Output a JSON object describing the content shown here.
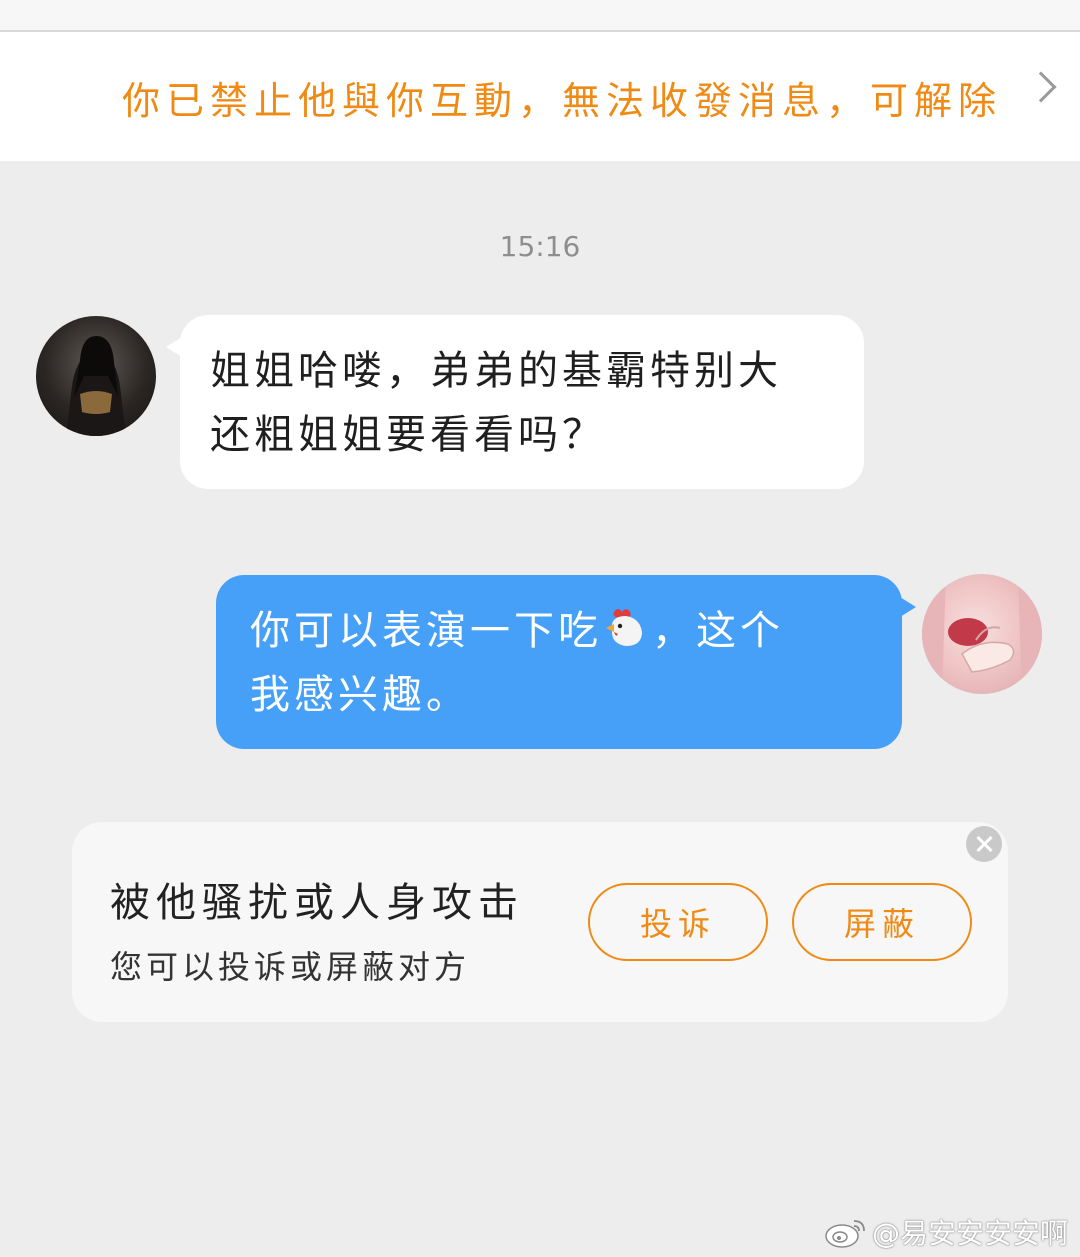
{
  "notice": {
    "text": "你已禁止他與你互動，無法收發消息，可解除"
  },
  "chat": {
    "timestamp": "15:16",
    "messages": [
      {
        "sender": "other",
        "lines": [
          "姐姐哈喽，弟弟的基霸特别大",
          "还粗姐姐要看看吗？"
        ]
      },
      {
        "sender": "self",
        "line1_before": "你可以表演一下吃",
        "emoji": "chicken-emoji",
        "line1_after": "，这个",
        "line2": "我感兴趣。"
      }
    ]
  },
  "report_card": {
    "title": "被他骚扰或人身攻击",
    "subtitle": "您可以投诉或屏蔽对方",
    "report_label": "投诉",
    "block_label": "屏蔽"
  },
  "watermark": {
    "text": "@易安安安安啊"
  },
  "colors": {
    "accent_orange": "#ef8a15",
    "self_bubble": "#46a0f7",
    "background": "#ededed"
  }
}
